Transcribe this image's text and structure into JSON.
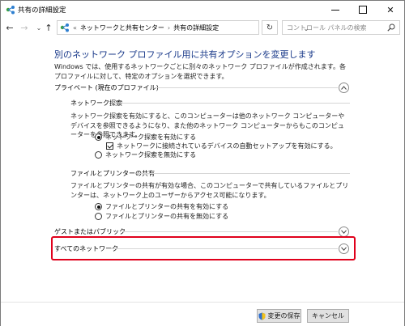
{
  "window": {
    "title": "共有の詳細設定"
  },
  "address_bar": {
    "overflow": "«",
    "crumbs": [
      "ネットワークと共有センター",
      "共有の詳細設定"
    ]
  },
  "search": {
    "placeholder": "コントロール パネルの検索"
  },
  "page": {
    "title": "別のネットワーク プロファイル用に共有オプションを変更します",
    "intro": "Windows では、使用するネットワークごとに別々のネットワーク プロファイルが作成されます。各プロファイルに対して、特定のオプションを選択できます。"
  },
  "private_section": {
    "heading": "プライベート (現在のプロファイル)",
    "expanded": true,
    "network_discovery": {
      "heading": "ネットワーク探索",
      "description": "ネットワーク探索を有効にすると、このコンピューターは他のネットワーク コンピューターやデバイスを参照できるようになり、また他のネットワーク コンピューターからもこのコンピューターを参照できます。",
      "options": [
        {
          "label": "ネットワーク探索を有効にする",
          "selected": true
        },
        {
          "label": "ネットワーク探索を無効にする",
          "selected": false
        }
      ],
      "auto_setup": {
        "label": "ネットワークに接続されているデバイスの自動セットアップを有効にする。",
        "checked": true
      }
    },
    "file_printer_sharing": {
      "heading": "ファイルとプリンターの共有",
      "description": "ファイルとプリンターの共有が有効な場合、このコンピューターで共有しているファイルとプリンターは、ネットワーク上のユーザーからアクセス可能になります。",
      "options": [
        {
          "label": "ファイルとプリンターの共有を有効にする",
          "selected": true
        },
        {
          "label": "ファイルとプリンターの共有を無効にする",
          "selected": false
        }
      ]
    }
  },
  "guest_section": {
    "heading": "ゲストまたはパブリック",
    "expanded": false
  },
  "all_networks_section": {
    "heading": "すべてのネットワーク",
    "expanded": false
  },
  "footer": {
    "save_label": "変更の保存",
    "cancel_label": "キャンセル"
  },
  "colors": {
    "title_blue": "#1a3a8a",
    "highlight_red": "#e0001b"
  }
}
